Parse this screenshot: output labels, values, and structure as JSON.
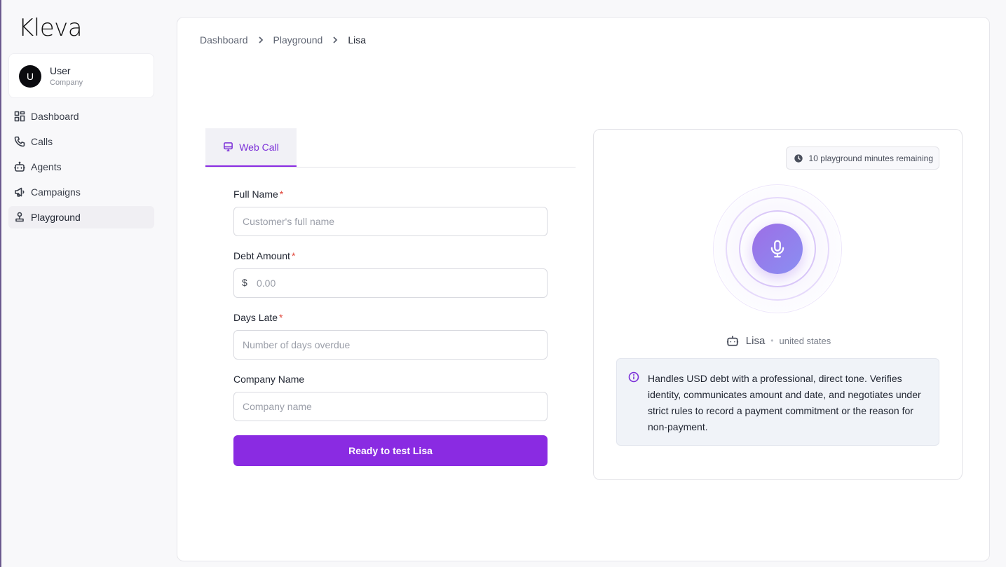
{
  "app": {
    "logo": "Kleva"
  },
  "user": {
    "initial": "U",
    "name": "User",
    "company": "Company"
  },
  "sidebar": {
    "items": [
      {
        "label": "Dashboard",
        "icon": "grid-icon"
      },
      {
        "label": "Calls",
        "icon": "phone-icon"
      },
      {
        "label": "Agents",
        "icon": "bot-icon"
      },
      {
        "label": "Campaigns",
        "icon": "megaphone-icon"
      },
      {
        "label": "Playground",
        "icon": "playground-icon",
        "active": true
      }
    ]
  },
  "breadcrumb": {
    "items": [
      "Dashboard",
      "Playground",
      "Lisa"
    ]
  },
  "tabs": [
    {
      "label": "Web Call",
      "icon": "monitor-icon",
      "active": true
    }
  ],
  "form": {
    "full_name": {
      "label": "Full Name",
      "required": "*",
      "placeholder": "Customer's full name"
    },
    "debt_amount": {
      "label": "Debt Amount",
      "required": "*",
      "prefix": "$",
      "placeholder": "0.00"
    },
    "days_late": {
      "label": "Days Late",
      "required": "*",
      "placeholder": "Number of days overdue"
    },
    "company_name": {
      "label": "Company Name",
      "placeholder": "Company name"
    },
    "submit_label": "Ready to test Lisa"
  },
  "panel": {
    "minutes_badge": "10 playground minutes remaining",
    "agent_name": "Lisa",
    "separator": "•",
    "agent_region": "united states",
    "description": "Handles USD debt with a professional, direct tone. Verifies identity, communicates amount and date, and negotiates under strict rules to record a payment commitment or the reason for non-payment."
  },
  "colors": {
    "accent": "#8a2be2",
    "required": "#e0463a"
  }
}
